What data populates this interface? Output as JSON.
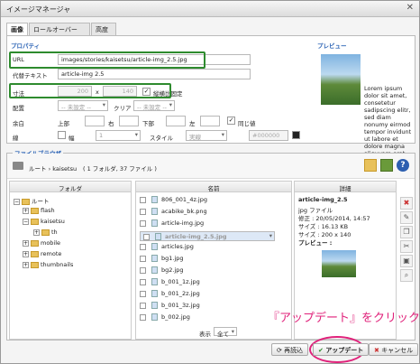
{
  "window": {
    "title": "イメージマネージャ",
    "close": "✕"
  },
  "tabs": [
    "画像",
    "ロールオーバー",
    "高度"
  ],
  "props": {
    "section": "プロパティ",
    "url_label": "URL",
    "url_value": "images/stories/kaisetsu/article-img_2.5.jpg",
    "alt_label": "代替テキスト",
    "alt_value": "article-img 2.5",
    "size_label": "寸法",
    "width": "200",
    "x": "x",
    "height": "140",
    "keep_ratio": "縦横比固定",
    "align_label": "配置",
    "align_value": "-- 未設定 --",
    "clear_label": "クリア",
    "clear_value": "-- 未設定 --",
    "margin_label": "余白",
    "margin_top": "上部",
    "margin_right": "右",
    "margin_bottom": "下部",
    "margin_left": "左",
    "same": "同じ値",
    "border_label": "線",
    "border_width": "1",
    "border_style_label": "スタイル",
    "border_style": "実線",
    "border_color": "#000000"
  },
  "preview": {
    "label": "プレビュー",
    "text": "Lorem ipsum dolor sit amet, consetetur sadipscing elitr, sed diam nonumy eirmod tempor invidunt ut labore et dolore magna aliquyam erat, sed diam voluptua."
  },
  "browser": {
    "section": "ファイルブラウザ",
    "path": "ルート › kaisetsu",
    "summary": "( 1 フォルダ, 37 ファイル )",
    "folder_col": "フォルダ",
    "name_col": "名前",
    "detail_col": "詳細",
    "tree": [
      "ルート",
      "flash",
      "kaisetsu",
      "th",
      "mobile",
      "remote",
      "thumbnails"
    ],
    "files": [
      "806_001_4z.jpg",
      "acabike_bk.png",
      "article-img.jpg",
      "article-img_2.5.jpg",
      "articles.jpg",
      "bg1.jpg",
      "bg2.jpg",
      "b_001_1z.jpg",
      "b_001_2z.jpg",
      "b_001_3z.jpg",
      "b_002.jpg"
    ],
    "show_label": "表示",
    "show_value": "全て",
    "detail": {
      "name": "article-img_2.5",
      "type": "jpg ファイル",
      "modified": "修正 : 20/05/2014, 14:57",
      "filesize": "サイズ : 16.13 KB",
      "dimensions": "サイズ : 200 x 140",
      "preview": "プレビュー :"
    }
  },
  "buttons": {
    "refresh": "再読込",
    "update": "アップデート",
    "cancel": "キャンセル"
  },
  "annotation": "『アップデート』をクリック"
}
